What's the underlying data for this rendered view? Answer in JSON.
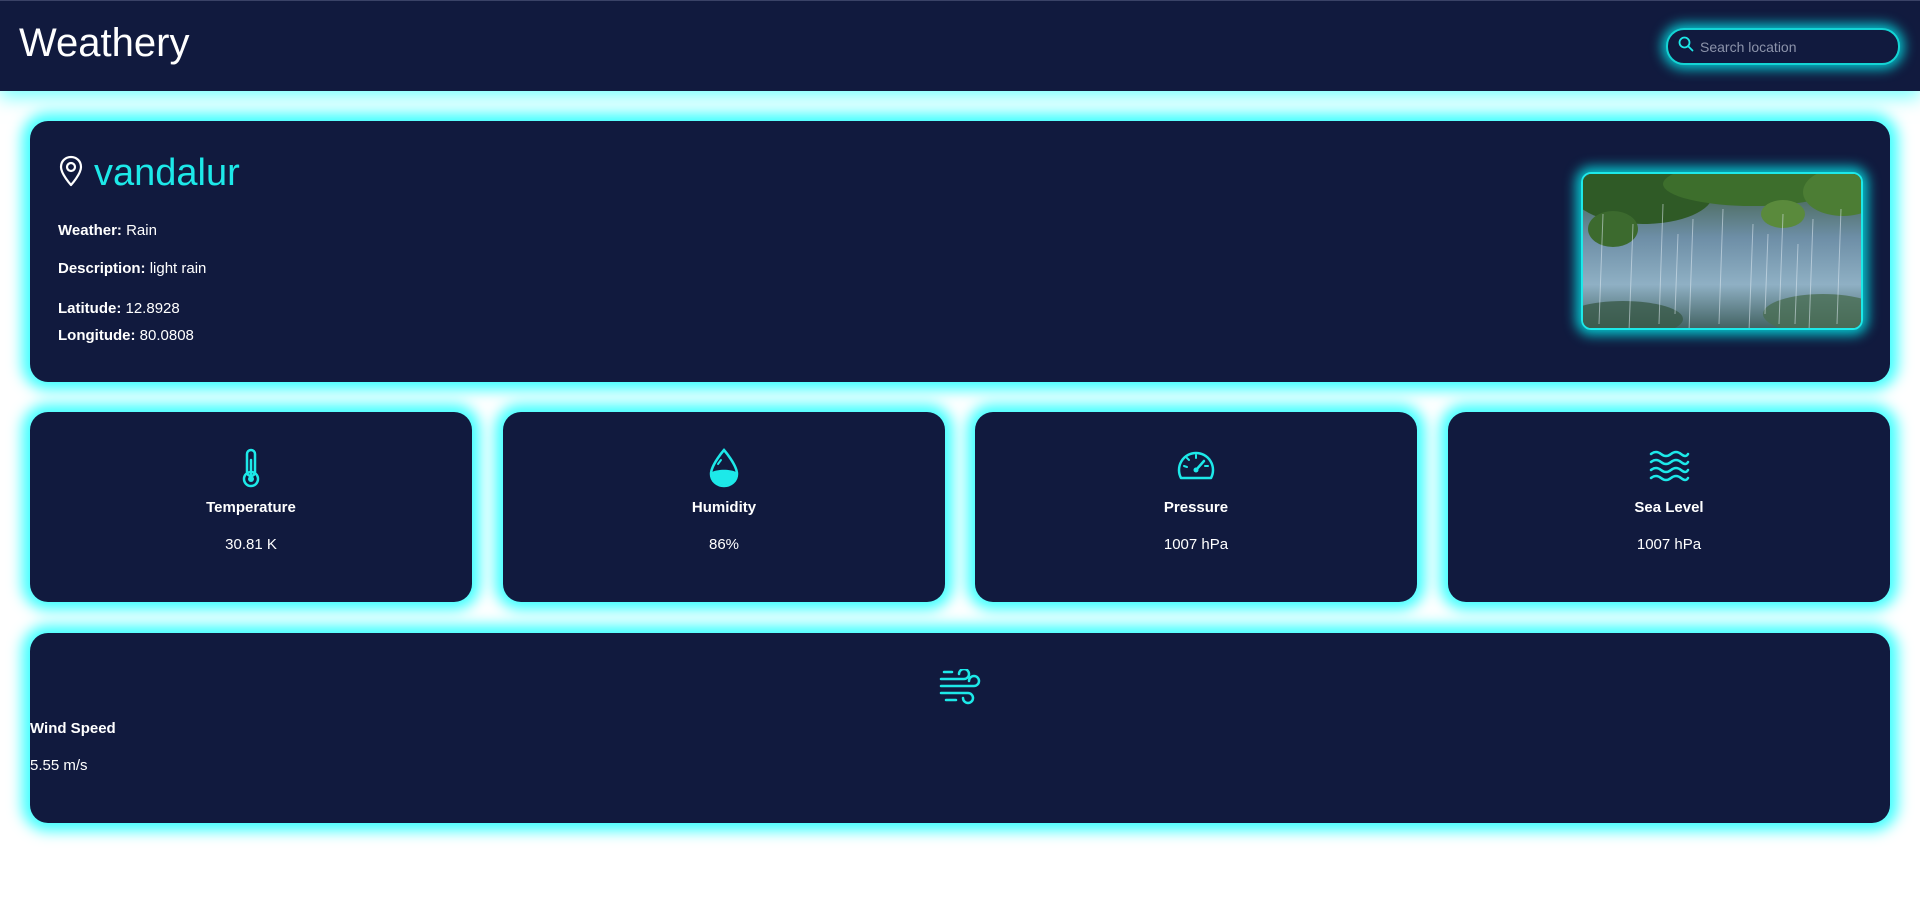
{
  "navbar": {
    "brand": "Weathery",
    "search_placeholder": "Search location"
  },
  "location": {
    "name": "vandalur",
    "weather_label": "Weather:",
    "weather": "Rain",
    "description_label": "Description:",
    "description": "light rain",
    "latitude_label": "Latitude:",
    "latitude": "12.8928",
    "longitude_label": "Longitude:",
    "longitude": "80.0808",
    "image_alt": "rain"
  },
  "stats": [
    {
      "title": "Temperature",
      "value": "30.81 K",
      "icon": "thermometer-icon"
    },
    {
      "title": "Humidity",
      "value": "86%",
      "icon": "droplet-icon"
    },
    {
      "title": "Pressure",
      "value": "1007 hPa",
      "icon": "gauge-icon"
    },
    {
      "title": "Sea Level",
      "value": "1007 hPa",
      "icon": "waves-icon"
    }
  ],
  "wind": {
    "title": "Wind Speed",
    "value": "5.55 m/s",
    "icon": "wind-icon"
  },
  "colors": {
    "navy": "#111a3e",
    "accent": "#1de9e9",
    "glow": "#00ffff"
  }
}
